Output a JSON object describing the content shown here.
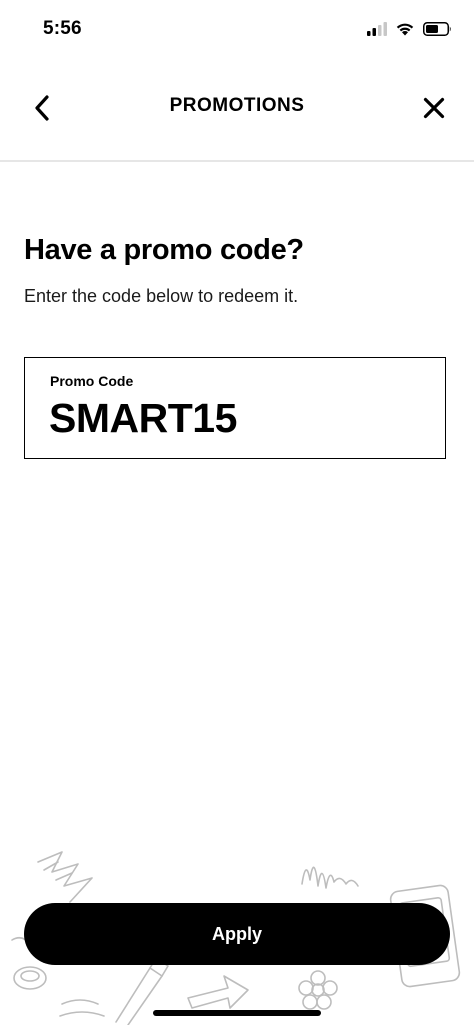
{
  "status_bar": {
    "time": "5:56",
    "signal_icon": "cellular-signal-icon",
    "wifi_icon": "wifi-icon",
    "battery_icon": "battery-icon"
  },
  "header": {
    "title": "PROMOTIONS",
    "back_icon": "chevron-left-icon",
    "close_icon": "close-icon"
  },
  "main": {
    "heading": "Have a promo code?",
    "subheading": "Enter the code below to redeem it.",
    "promo_field": {
      "label": "Promo Code",
      "value": "SMART15"
    }
  },
  "footer": {
    "apply_label": "Apply"
  },
  "colors": {
    "primary": "#000000",
    "background": "#ffffff",
    "divider": "#e6e6e6",
    "doodle": "#bdbdbd"
  }
}
